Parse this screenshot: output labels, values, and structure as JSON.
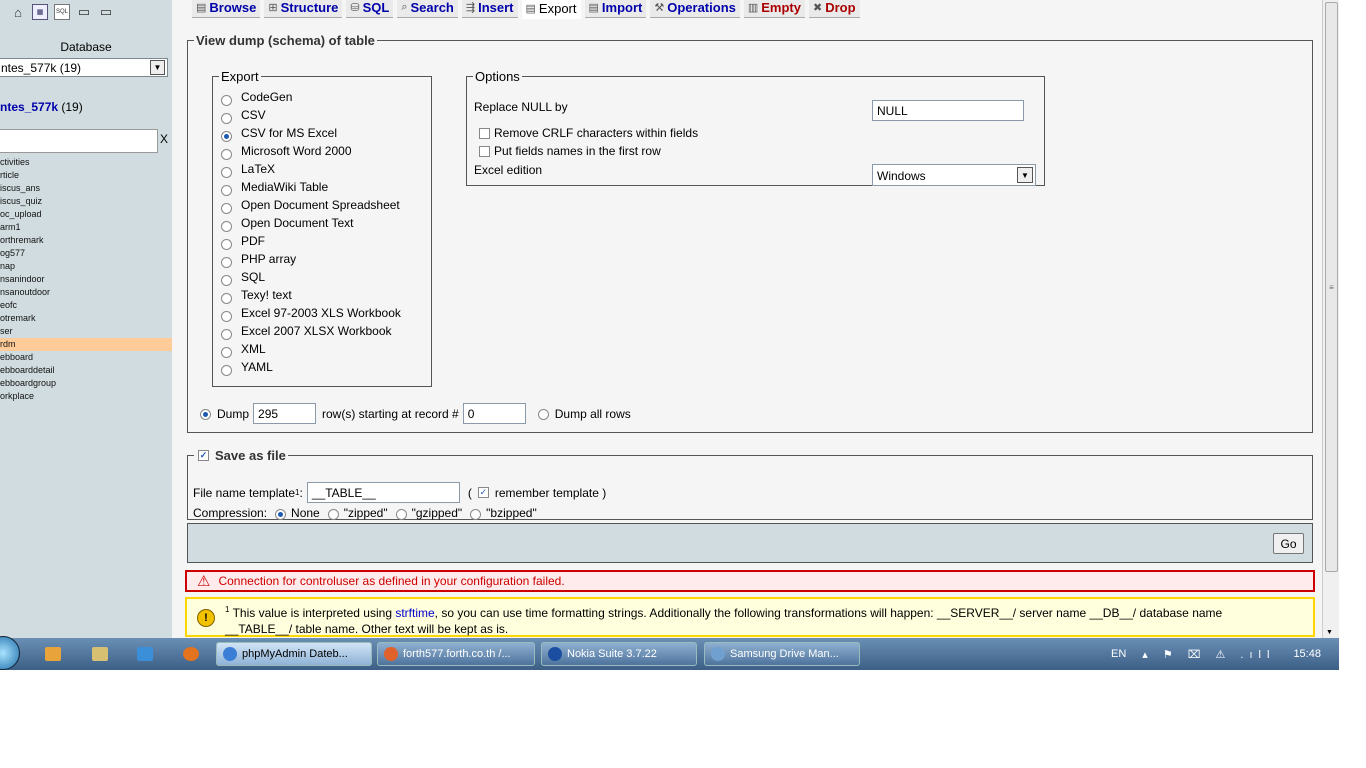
{
  "sidebar": {
    "database_label": "Database",
    "selected_db": "ntes_577k (19)",
    "db_title_link": "ntes_577k",
    "db_title_count": " (19)",
    "filter_clear": "X",
    "tables": [
      "ctivities",
      "rticle",
      "iscus_ans",
      "iscus_quiz",
      "oc_upload",
      "arm1",
      "orthremark",
      "og577",
      "nap",
      "nsanindoor",
      "nsanoutdoor",
      "eofc",
      "otremark",
      "ser",
      "rdm",
      "ebboard",
      "ebboarddetail",
      "ebboardgroup",
      "orkplace"
    ],
    "active_table": "rdm"
  },
  "tabs": [
    {
      "label": "Browse",
      "icon": "▤"
    },
    {
      "label": "Structure",
      "icon": "⊞"
    },
    {
      "label": "SQL",
      "icon": "⛁"
    },
    {
      "label": "Search",
      "icon": "⌕"
    },
    {
      "label": "Insert",
      "icon": "⇶"
    },
    {
      "label": "Export",
      "icon": "▤"
    },
    {
      "label": "Import",
      "icon": "▤"
    },
    {
      "label": "Operations",
      "icon": "⚒"
    },
    {
      "label": "Empty",
      "icon": "▥"
    },
    {
      "label": "Drop",
      "icon": "✖"
    }
  ],
  "dump": {
    "legend": "View dump (schema) of table",
    "export_legend": "Export",
    "formats": [
      "CodeGen",
      "CSV",
      "CSV for MS Excel",
      "Microsoft Word 2000",
      "LaTeX",
      "MediaWiki Table",
      "Open Document Spreadsheet",
      "Open Document Text",
      "PDF",
      "PHP array",
      "SQL",
      "Texy! text",
      "Excel 97-2003 XLS Workbook",
      "Excel 2007 XLSX Workbook",
      "XML",
      "YAML"
    ],
    "selected_format": "CSV for MS Excel",
    "options_legend": "Options",
    "replace_null_label": "Replace NULL by",
    "replace_null_value": "NULL",
    "remove_crlf_label": "Remove CRLF characters within fields",
    "field_names_label": "Put fields names in the first row",
    "excel_edition_label": "Excel edition",
    "excel_edition_value": "Windows",
    "dump_label": "Dump",
    "dump_rows": "295",
    "rows_starting_label": "row(s) starting at record #",
    "start_record": "0",
    "dump_all_label": "Dump all rows"
  },
  "save": {
    "legend": "Save as file",
    "file_template_label": "File name template",
    "footnote_mark": "1",
    "file_template_sep": " :",
    "file_template_value": "__TABLE__",
    "remember_open": "(",
    "remember_label": "remember template )",
    "compression_label": "Compression:",
    "compression_options": [
      "None",
      "\"zipped\"",
      "\"gzipped\"",
      "\"bzipped\""
    ]
  },
  "go_label": "Go",
  "error_text": "Connection for controluser as defined in your configuration failed.",
  "notice": {
    "footnote": "1",
    "pre_link": " This value is interpreted using ",
    "link": "strftime",
    "post_link": ", so you can use time formatting strings. Additionally the following transformations will happen: __SERVER__/ server name __DB__/ database name",
    "line2": "__TABLE__/ table name. Other text will be kept as is."
  },
  "taskbar": {
    "buttons": [
      {
        "label": "phpMyAdmin Dateb...",
        "color": "#3a7fd5"
      },
      {
        "label": "forth577.forth.co.th /...",
        "color": "#e0622a"
      },
      {
        "label": "Nokia Suite 3.7.22",
        "color": "#1b4ea0"
      },
      {
        "label": "Samsung Drive Man...",
        "color": "#6fa0d0"
      }
    ],
    "lang": "EN",
    "tray_icons": "▴ ⚑ ⌧ ⚠ .ıll",
    "clock": "15:48"
  }
}
